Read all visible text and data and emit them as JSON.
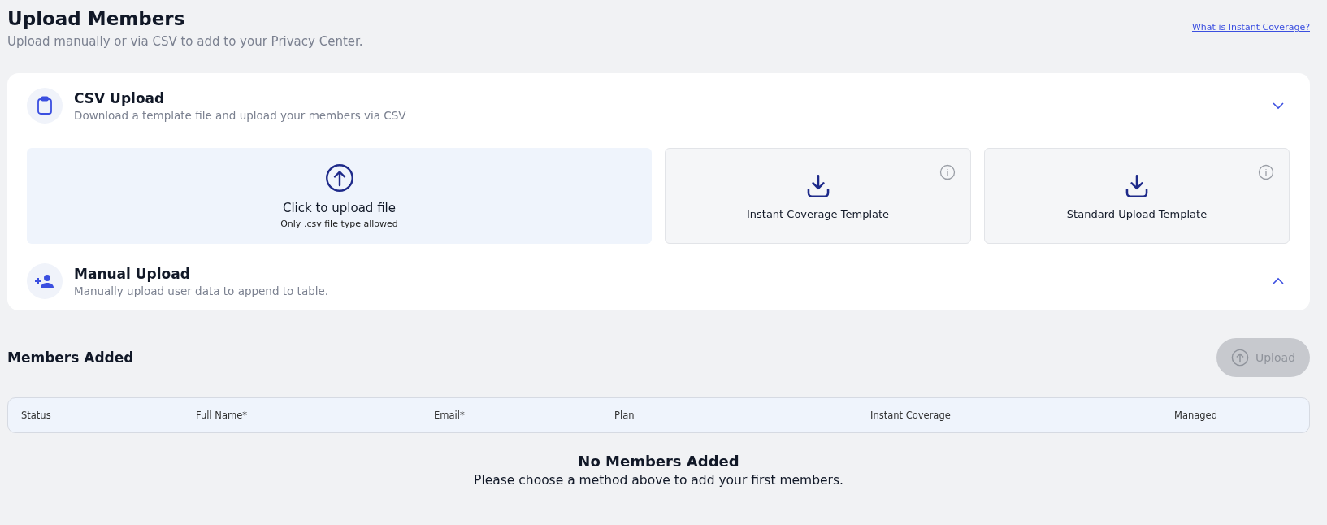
{
  "header": {
    "title": "Upload Members",
    "subtitle": "Upload manually or via CSV to add to your Privacy Center.",
    "help_link": "What is Instant Coverage?"
  },
  "sections": [
    {
      "kind": "csv",
      "title": "CSV Upload",
      "description": "Download a template file and upload your members via CSV",
      "expanded": true,
      "dropzone": {
        "title": "Click to upload file",
        "hint": "Only .csv file type allowed"
      },
      "templates": [
        {
          "label": "Instant Coverage Template"
        },
        {
          "label": "Standard Upload Template"
        }
      ]
    },
    {
      "kind": "manual",
      "title": "Manual Upload",
      "description": "Manually upload user data to append to table.",
      "expanded": false
    }
  ],
  "members": {
    "title": "Members Added",
    "upload_button": {
      "label": "Upload",
      "disabled": true
    },
    "columns": [
      "Status",
      "Full Name*",
      "Email*",
      "Plan",
      "Instant Coverage",
      "Managed"
    ],
    "empty_title": "No Members Added",
    "empty_text": "Please choose a method above to add your first members."
  }
}
